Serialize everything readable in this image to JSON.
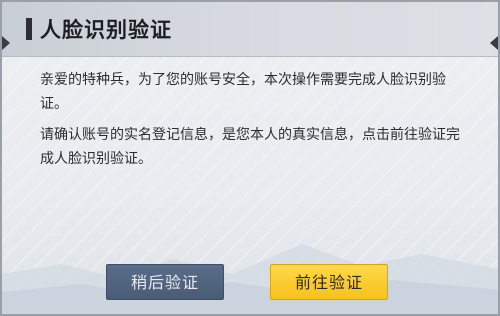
{
  "dialog": {
    "title": "人脸识别验证",
    "paragraph_1": "亲爱的特种兵，为了您的账号安全，本次操作需要完成人脸识别验证。",
    "paragraph_2": "请确认账号的实名登记信息，是您本人的真实信息，点击前往验证完成人脸识别验证。"
  },
  "buttons": {
    "later_label": "稍后验证",
    "go_label": "前往验证"
  },
  "colors": {
    "later_button": "#4e6079",
    "go_button": "#f8c825",
    "dialog_background": "#eceff2"
  }
}
